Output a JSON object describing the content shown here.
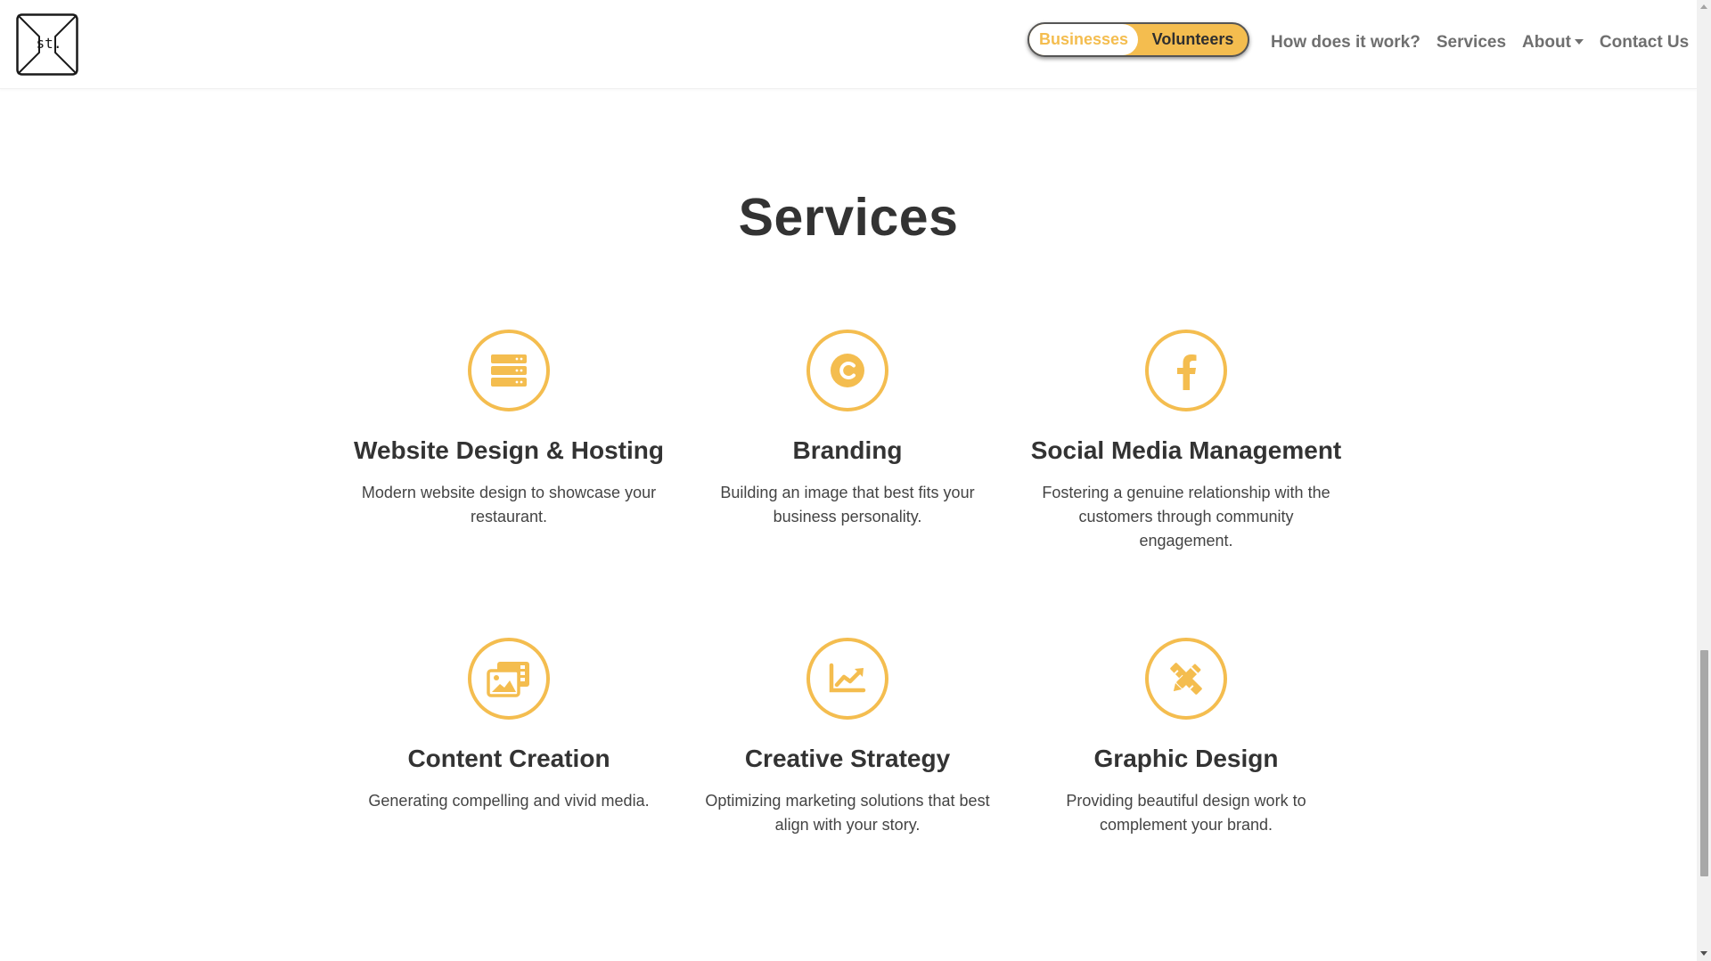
{
  "brand": {
    "logo_text": "st.",
    "logo_icon": "logo-icon"
  },
  "toggle": {
    "businesses_label": "Businesses",
    "volunteers_label": "Volunteers"
  },
  "nav": {
    "how_label": "How does it work?",
    "services_label": "Services",
    "about_label": "About",
    "contact_label": "Contact Us"
  },
  "section": {
    "title": "Services"
  },
  "services": [
    {
      "icon": "server-icon",
      "title": "Website Design & Hosting",
      "description": "Modern website design to showcase your restaurant."
    },
    {
      "icon": "copyright-icon",
      "title": "Branding",
      "description": "Building an image that best fits your business personality."
    },
    {
      "icon": "facebook-icon",
      "title": "Social Media Management",
      "description": "Fostering a genuine relationship with the customers through community engagement."
    },
    {
      "icon": "images-icon",
      "title": "Content Creation",
      "description": "Generating compelling and vivid media."
    },
    {
      "icon": "chart-line-icon",
      "title": "Creative Strategy",
      "description": "Optimizing marketing solutions that best align with your story."
    },
    {
      "icon": "pencil-ruler-icon",
      "title": "Graphic Design",
      "description": "Providing beautiful design work to complement your brand."
    }
  ],
  "colors": {
    "accent": "#f4bd4f",
    "heading": "#333333",
    "nav_text": "#6f6f6f"
  }
}
